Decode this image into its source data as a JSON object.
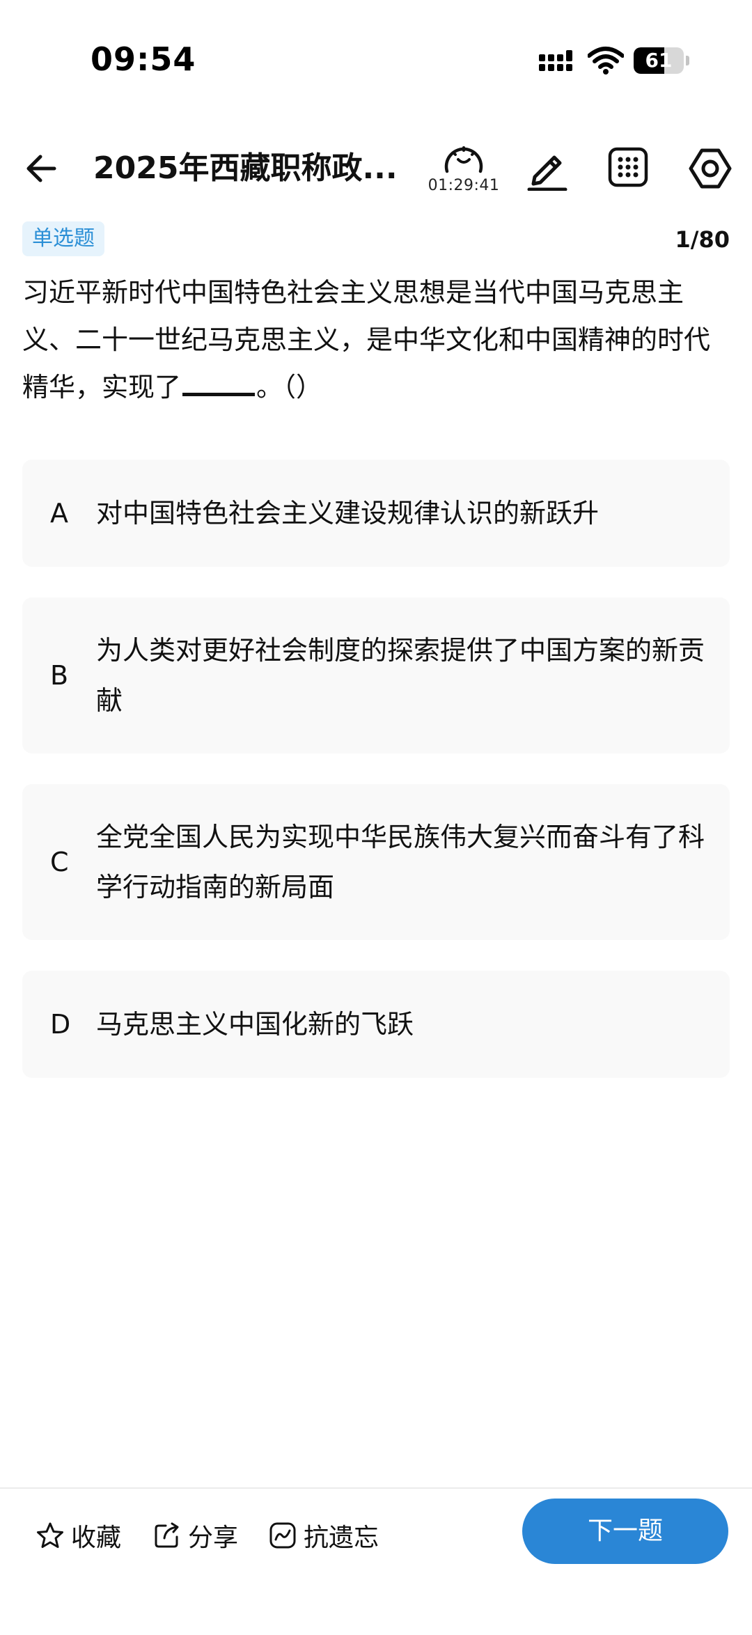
{
  "status_bar": {
    "time": "09:54",
    "battery_level": "61",
    "battery_fraction": 0.61
  },
  "header": {
    "back_icon": "arrow-left-icon",
    "title": "2025年西藏职称政...",
    "timer": "01:29:41",
    "timer_icon": "clock-icon",
    "edit_icon": "pencil-icon",
    "grid_icon": "grid-icon",
    "settings_icon": "hexagon-settings-icon"
  },
  "question": {
    "type_label": "单选题",
    "progress": "1/80",
    "text_before_blank": "习近平新时代中国特色社会主义思想是当代中国马克思主义、二十一世纪马克思主义，是中华文化和中国精神的时代精华，实现了",
    "text_after_blank": "。（）"
  },
  "options": [
    {
      "letter": "A",
      "text": "对中国特色社会主义建设规律认识的新跃升"
    },
    {
      "letter": "B",
      "text": "为人类对更好社会制度的探索提供了中国方案的新贡献"
    },
    {
      "letter": "C",
      "text": "全党全国人民为实现中华民族伟大复兴而奋斗有了科学行动指南的新局面"
    },
    {
      "letter": "D",
      "text": "马克思主义中国化新的飞跃"
    }
  ],
  "bottom_bar": {
    "favorite_label": "收藏",
    "favorite_icon": "star-icon",
    "share_label": "分享",
    "share_icon": "share-icon",
    "memory_label": "抗遗忘",
    "memory_icon": "trend-icon",
    "next_label": "下一题"
  },
  "colors": {
    "accent": "#2a86d6",
    "badge_bg": "#e6f3fc",
    "badge_text": "#2b8fd6",
    "option_bg": "#f9f9f9"
  }
}
